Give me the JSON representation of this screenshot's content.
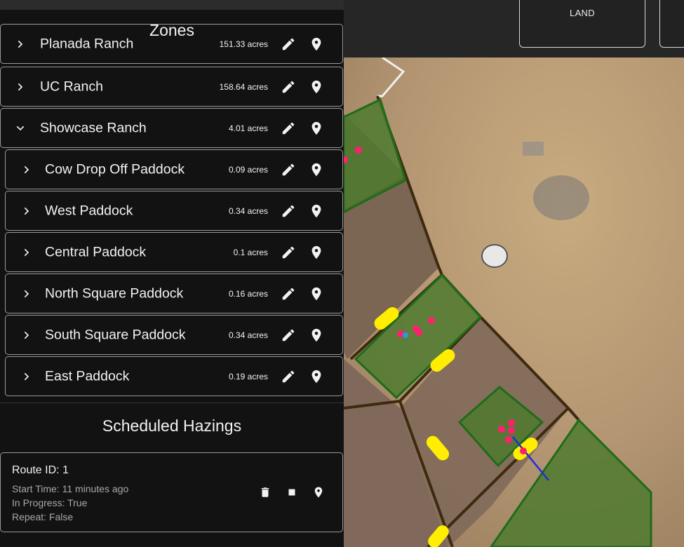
{
  "top_bar": {
    "land_label": "LAND"
  },
  "zones": {
    "title": "Zones",
    "items": [
      {
        "name": "Planada Ranch",
        "acres": "151.33 acres",
        "expanded": false
      },
      {
        "name": "UC Ranch",
        "acres": "158.64 acres",
        "expanded": false
      },
      {
        "name": "Showcase Ranch",
        "acres": "4.01 acres",
        "expanded": true
      },
      {
        "name": "Cow Drop Off Paddock",
        "acres": "0.09 acres",
        "expanded": false
      },
      {
        "name": "West Paddock",
        "acres": "0.34 acres",
        "expanded": false
      },
      {
        "name": "Central Paddock",
        "acres": "0.1 acres",
        "expanded": false
      },
      {
        "name": "North Square Paddock",
        "acres": "0.16 acres",
        "expanded": false
      },
      {
        "name": "South Square Paddock",
        "acres": "0.34 acres",
        "expanded": false
      },
      {
        "name": "East Paddock",
        "acres": "0.19 acres",
        "expanded": false
      }
    ]
  },
  "hazings": {
    "title": "Scheduled Hazings",
    "card": {
      "route": "Route ID: 1",
      "start_time": "Start Time: 11 minutes ago",
      "in_progress": "In Progress: True",
      "repeat": "Repeat: False"
    }
  },
  "colors": {
    "panel_bg": "#121212",
    "paddock_fill": "#4f7a2f",
    "paddock_border": "#1f6b1a",
    "fence": "#3d2a10",
    "cow": "#ff1f6e",
    "marker": "#ffee00",
    "route_line": "#1a2ee0"
  },
  "icons": {
    "chevron_collapsed": "chevron-right-icon",
    "chevron_expanded": "chevron-down-icon",
    "edit": "pencil-icon",
    "locate": "map-pin-icon",
    "delete": "trash-icon",
    "stop": "stop-icon"
  }
}
